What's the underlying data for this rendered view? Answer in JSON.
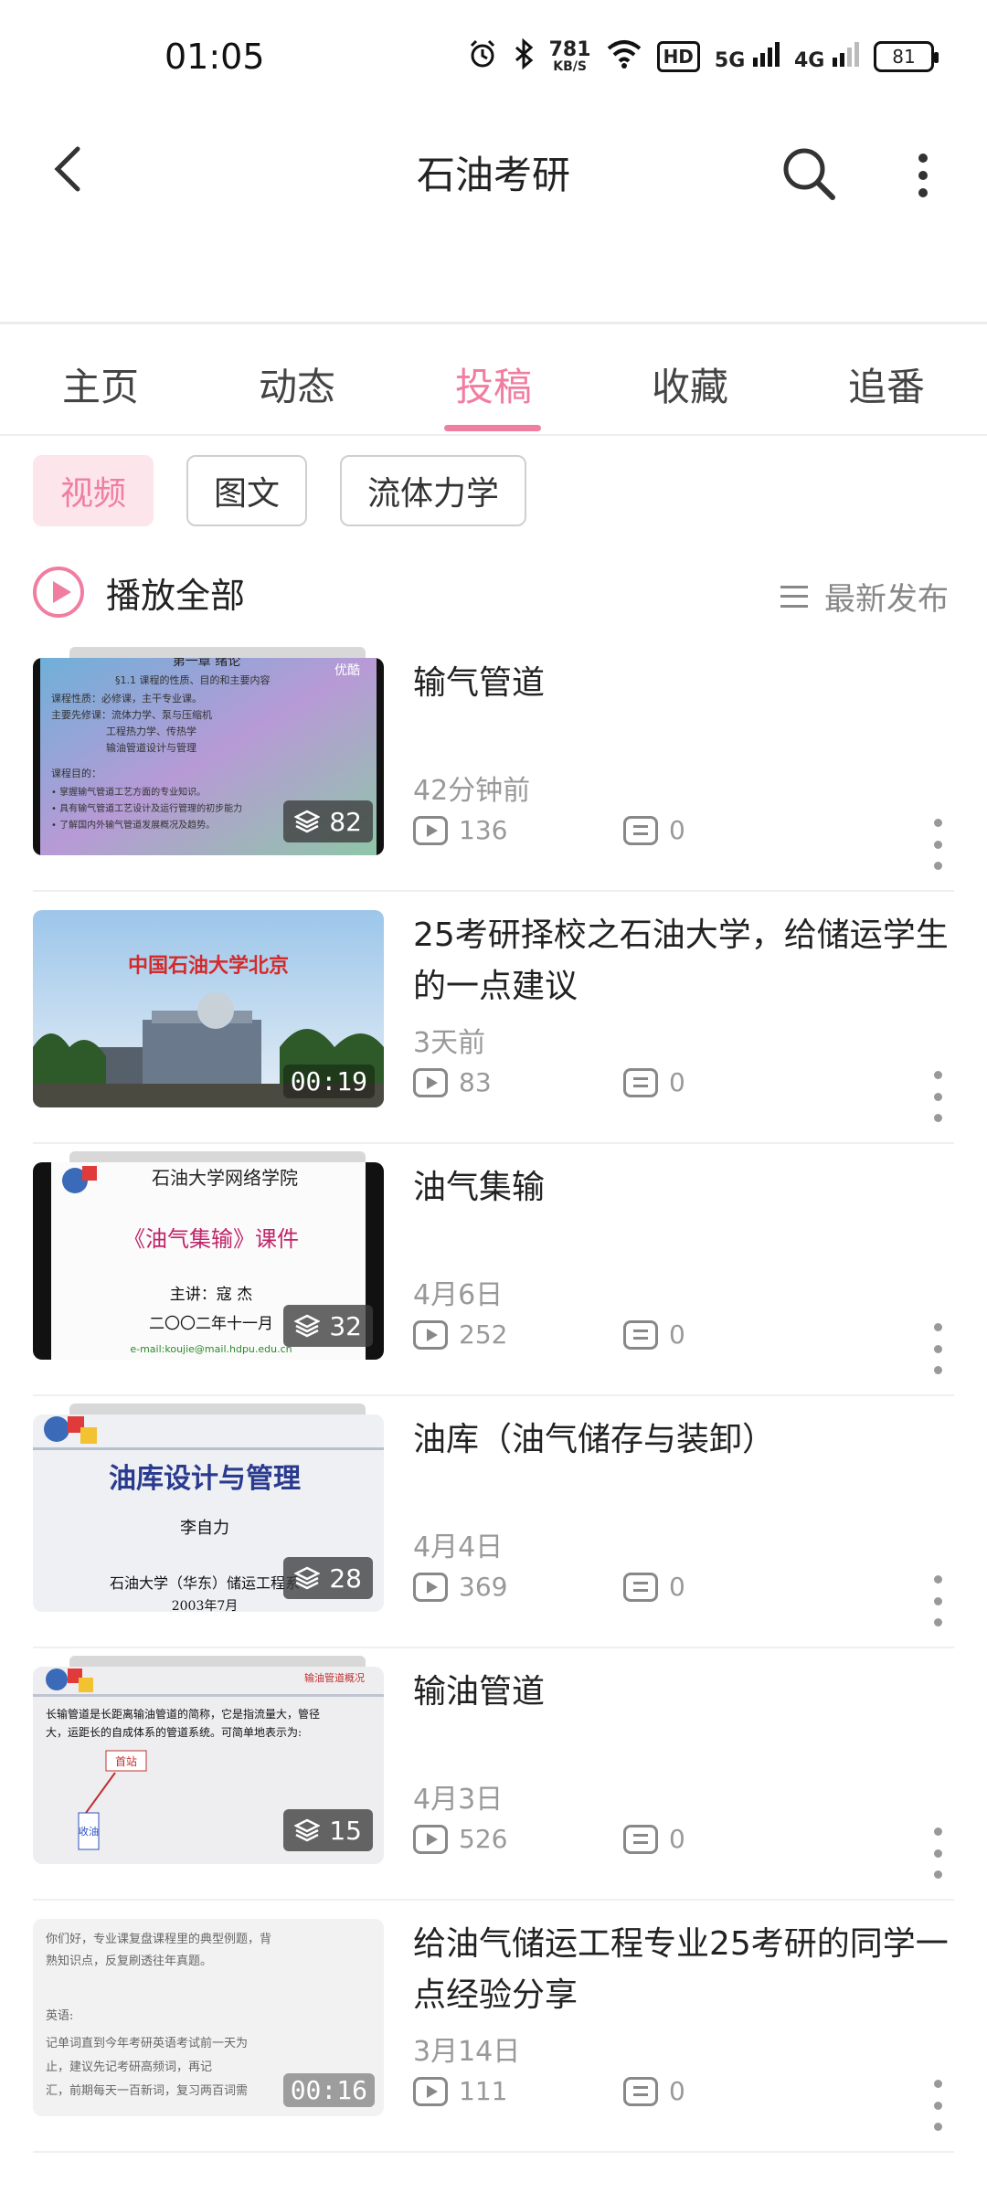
{
  "status_bar": {
    "time": "01:05",
    "speed_value": "781",
    "speed_unit": "KB/S",
    "hd_label": "HD",
    "net1": "5G",
    "net2": "4G",
    "battery": "81"
  },
  "header": {
    "title": "石油考研"
  },
  "tabs": [
    {
      "label": "主页"
    },
    {
      "label": "动态"
    },
    {
      "label": "投稿",
      "active": true
    },
    {
      "label": "收藏"
    },
    {
      "label": "追番"
    }
  ],
  "filters": [
    {
      "label": "视频",
      "active": true
    },
    {
      "label": "图文"
    },
    {
      "label": "流体力学"
    }
  ],
  "play_all_label": "播放全部",
  "sort_label": "最新发布",
  "colors": {
    "accent": "#f07ea0"
  },
  "videos": [
    {
      "title": "输气管道",
      "time": "42分钟前",
      "views": "136",
      "comments": "0",
      "badge": "82",
      "badge_type": "collection"
    },
    {
      "title": "25考研择校之石油大学，给储运学生的一点建议",
      "time": "3天前",
      "views": "83",
      "comments": "0",
      "badge": "00:19",
      "badge_type": "duration"
    },
    {
      "title": "油气集输",
      "time": "4月6日",
      "views": "252",
      "comments": "0",
      "badge": "32",
      "badge_type": "collection"
    },
    {
      "title": "油库（油气储存与装卸）",
      "time": "4月4日",
      "views": "369",
      "comments": "0",
      "badge": "28",
      "badge_type": "collection"
    },
    {
      "title": "输油管道",
      "time": "4月3日",
      "views": "526",
      "comments": "0",
      "badge": "15",
      "badge_type": "collection"
    },
    {
      "title": "给油气储运工程专业25考研的同学一点经验分享",
      "time": "3月14日",
      "views": "111",
      "comments": "0",
      "badge": "00:16",
      "badge_type": "duration"
    }
  ],
  "thumbs": {
    "t1_heading": "第一章 绪论",
    "t1_watermark": "优酷",
    "t1_lines": [
      "§1.1 课程的性质、目的和主要内容",
      "课程性质：必修课，主干专业课。",
      "主要先修课：流体力学、泵与压缩机",
      "工程热力学、传热学",
      "输油管道设计与管理",
      "课程目的：",
      "• 掌握输气管道工艺方面的专业知识。",
      "• 具有输气管道工艺设计及运行管理的初步能力",
      "• 了解国内外输气管道发展概况及趋势。"
    ],
    "t2_caption": "中国石油大学北京",
    "t3_header": "石油大学网络学院",
    "t3_title": "《油气集输》课件",
    "t3_lecturer": "主讲：寇 杰",
    "t3_date": "二〇〇二年十一月",
    "t3_email": "e-mail:koujie@mail.hdpu.edu.cn",
    "t4_title": "油库设计与管理",
    "t4_author": "李自力",
    "t4_org": "石油大学（华东）储运工程系",
    "t4_date": "2003年7月",
    "t5_tag": "输油管道概况",
    "t5_text1": "长输管道是长距离输油管道的简称，它是指流量大，管径",
    "t5_text2": "大，运距长的自成体系的管道系统。可简单地表示为:",
    "t5_box1": "首站",
    "t5_box2": "收油",
    "t6_lines": [
      "你们好，专业课复盘课程里的典型例题，背",
      "熟知识点，反复刷透往年真题。",
      "",
      "英语:",
      "   记单词直到今年考研英语考试前一天为",
      "   止，建议先记考研高频词，再记",
      "   汇，前期每天一百新词，复习两百词需"
    ]
  }
}
